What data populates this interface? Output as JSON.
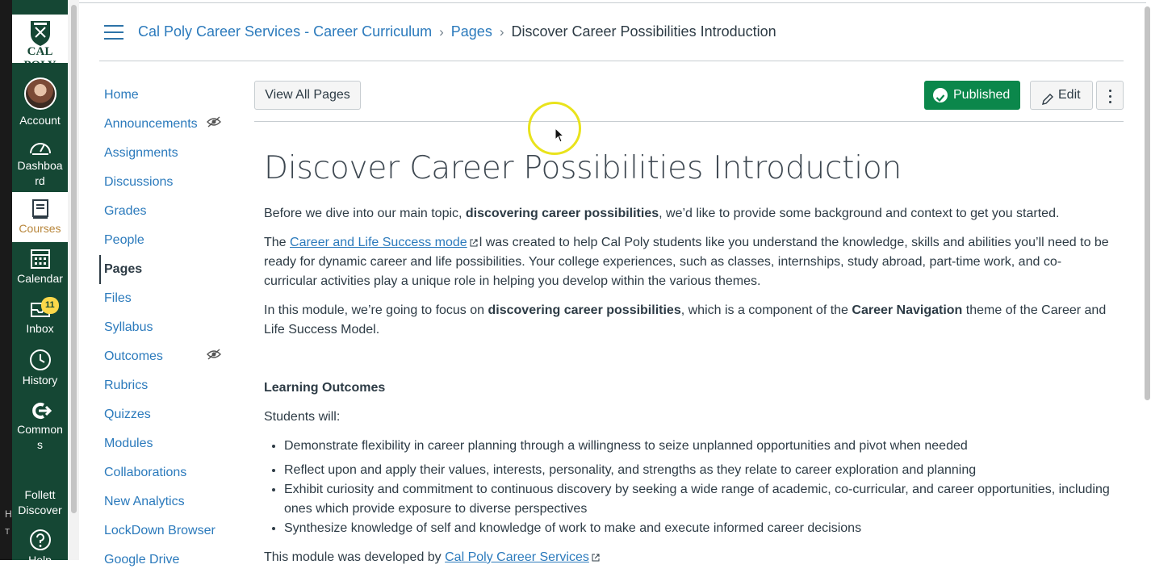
{
  "global_nav": {
    "logo_text": "CAL POLY",
    "items": [
      {
        "label": "Account",
        "icon": "avatar"
      },
      {
        "label": "Dashboard",
        "icon": "dashboard-icon"
      },
      {
        "label": "Courses",
        "icon": "courses-icon"
      },
      {
        "label": "Calendar",
        "icon": "calendar-icon"
      },
      {
        "label": "Inbox",
        "icon": "inbox-icon",
        "badge": "11"
      },
      {
        "label": "History",
        "icon": "history-icon"
      },
      {
        "label": "Commons",
        "icon": "commons-icon"
      },
      {
        "label": "Follett Discover"
      },
      {
        "label": "Help",
        "icon": "help-icon"
      }
    ]
  },
  "breadcrumb": {
    "course": "Cal Poly Career Services - Career Curriculum",
    "section": "Pages",
    "current": "Discover Career Possibilities Introduction"
  },
  "course_nav": [
    {
      "label": "Home"
    },
    {
      "label": "Announcements",
      "hidden": true
    },
    {
      "label": "Assignments"
    },
    {
      "label": "Discussions"
    },
    {
      "label": "Grades"
    },
    {
      "label": "People"
    },
    {
      "label": "Pages",
      "active": true
    },
    {
      "label": "Files"
    },
    {
      "label": "Syllabus"
    },
    {
      "label": "Outcomes",
      "hidden": true
    },
    {
      "label": "Rubrics"
    },
    {
      "label": "Quizzes"
    },
    {
      "label": "Modules"
    },
    {
      "label": "Collaborations"
    },
    {
      "label": "New Analytics"
    },
    {
      "label": "LockDown Browser"
    },
    {
      "label": "Google Drive"
    }
  ],
  "toolbar": {
    "view_all": "View All Pages",
    "published": "Published",
    "edit": "Edit"
  },
  "page": {
    "title": "Discover Career Possibilities Introduction",
    "p1_a": "Before we dive into our main topic, ",
    "p1_b": "discovering career possibilities",
    "p1_c": ", we’d like to provide some background and context to get you started.",
    "p2_a": "The ",
    "p2_link": "Career and Life Success mode",
    "p2_b": "l was created to help Cal Poly students like you understand the knowledge, skills and abilities you’ll need to be ready for dynamic career and life possibilities. Your college experiences, such as classes, internships, study abroad, part-time work, and co-curricular activities play a unique role in helping you develop within the various themes.",
    "p3_a": "In this module, we’re going to focus on ",
    "p3_b": "discovering career possibilities",
    "p3_c": ", which is a component of the ",
    "p3_d": "Career Navigation",
    "p3_e": " theme of the Career and Life Success Model.",
    "outcomes_heading": "Learning Outcomes",
    "students_will": "Students will:",
    "outcomes": [
      "Demonstrate flexibility in career planning through a willingness to seize unplanned opportunities and pivot when needed",
      "Reflect upon and apply their values, interests, personality, and strengths as they relate to career exploration and planning",
      "Exhibit curiosity and commitment to continuous discovery by seeking a wide range of academic, co-curricular, and career opportunities, including ones which provide exposure to diverse perspectives",
      "Synthesize knowledge of self and knowledge of work to make and execute informed career decisions"
    ],
    "footer_a": "This module was developed by ",
    "footer_link": "Cal Poly Career Services"
  },
  "edge_fragments": [
    "H",
    "T"
  ],
  "colors": {
    "nav_bg": "#154734",
    "link": "#2b7abc",
    "published": "#0b874b",
    "active_course": "#b8863b"
  }
}
